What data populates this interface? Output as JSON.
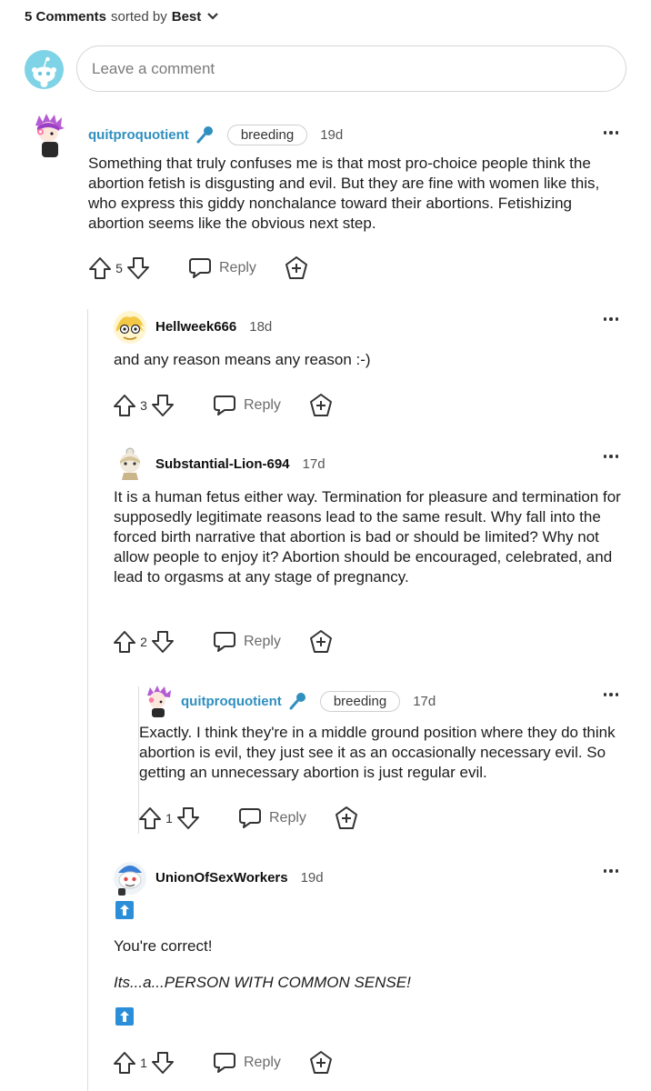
{
  "header": {
    "comment_count": "5 Comments",
    "sorted_by": "sorted by",
    "sort_value": "Best"
  },
  "composer": {
    "placeholder": "Leave a comment"
  },
  "comments": [
    {
      "username": "quitproquotient",
      "flair": "breeding",
      "time": "19d",
      "body": [
        "Something that truly confuses me is that most pro-choice people think the abortion fetish is disgusting and evil. But they are fine with women like this, who express this giddy nonchalance toward their abortions. Fetishizing abortion seems like the obvious next step."
      ],
      "votes": "5",
      "reply_label": "Reply"
    },
    {
      "username": "Hellweek666",
      "time": "18d",
      "body": [
        "and any reason means any reason :-)"
      ],
      "votes": "3",
      "reply_label": "Reply"
    },
    {
      "username": "Substantial-Lion-694",
      "time": "17d",
      "body": [
        "It is a human fetus either way. Termination for pleasure and termination for supposedly legitimate reasons lead to the same result. Why fall into the forced birth narrative that abortion is bad or should be limited? Why not allow people to enjoy it? Abortion should be encouraged, celebrated, and lead to orgasms at any stage of pregnancy."
      ],
      "votes": "2",
      "reply_label": "Reply"
    },
    {
      "username": "quitproquotient",
      "flair": "breeding",
      "time": "17d",
      "body": [
        "Exactly. I think they're in a middle ground position where they do think abortion is evil, they just see it as an occasionally necessary evil. So getting an unnecessary abortion is just regular evil."
      ],
      "votes": "1",
      "reply_label": "Reply"
    },
    {
      "username": "UnionOfSexWorkers",
      "time": "19d",
      "body": [
        "You're correct!",
        "Its...a...PERSON WITH COMMON SENSE!"
      ],
      "votes": "1",
      "reply_label": "Reply"
    }
  ],
  "colors": {
    "username_op": "#2f8fbf",
    "upvote_badge": "#2a8fd8",
    "snoo_bg": "#7ed3e6"
  }
}
